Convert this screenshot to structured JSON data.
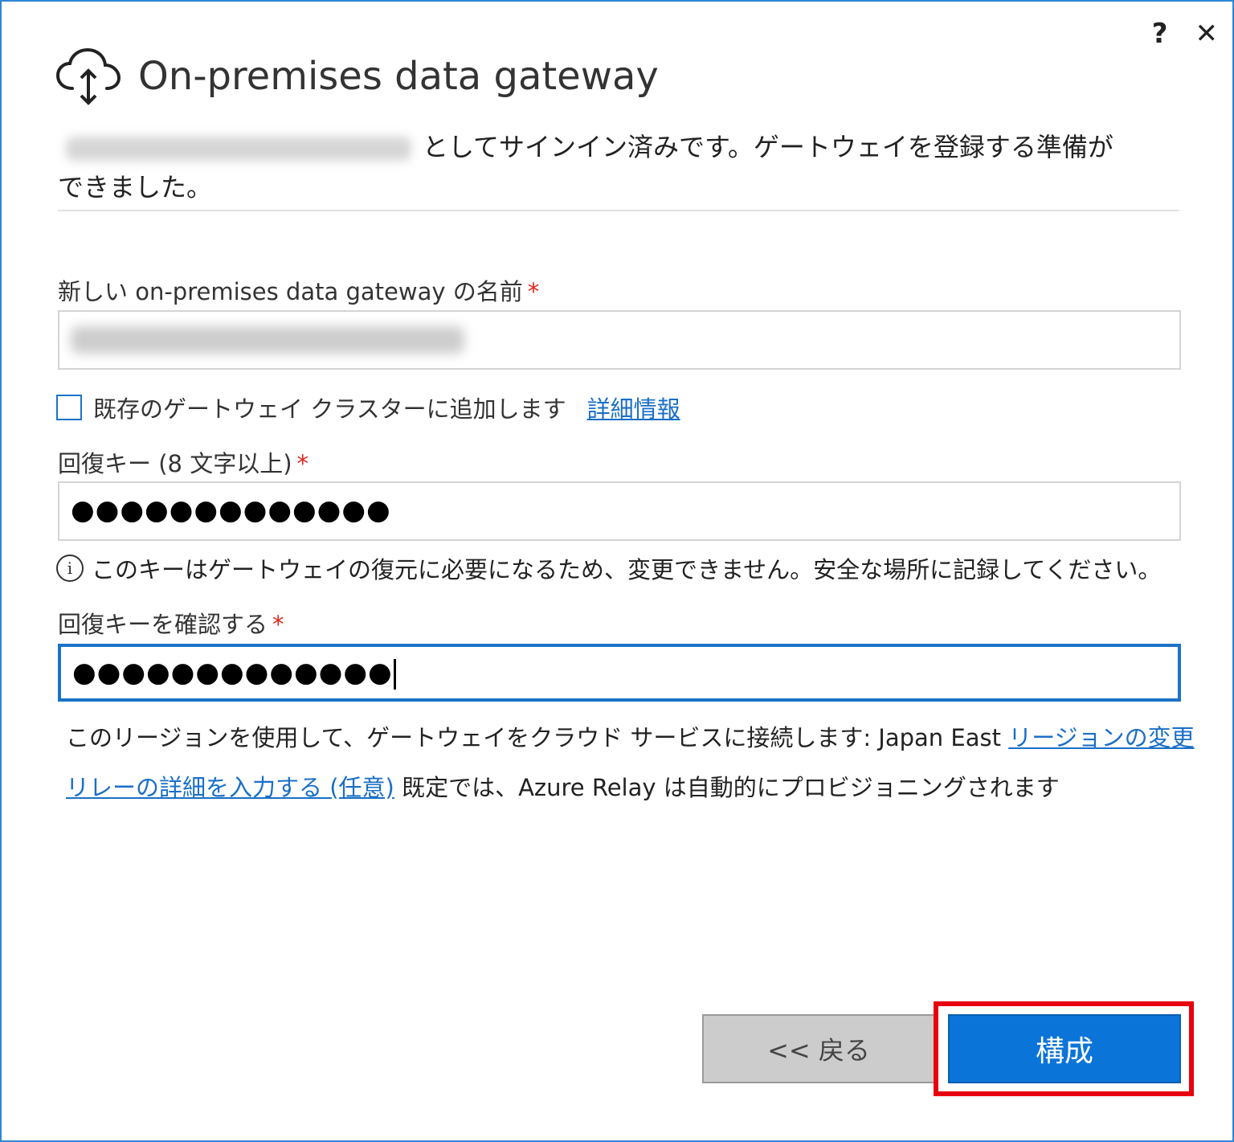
{
  "window": {
    "help_label": "?",
    "close_label": "✕"
  },
  "header": {
    "title": "On-premises data gateway",
    "icon": "cloud-upload-icon"
  },
  "signed_in": {
    "message": "としてサインイン済みです。ゲートウェイを登録する準備ができました。"
  },
  "gateway_name": {
    "label": "新しい on-premises data gateway の名前",
    "required_mark": "*"
  },
  "cluster": {
    "checkbox_label": "既存のゲートウェイ クラスターに追加します",
    "checked": false,
    "learn_more": "詳細情報"
  },
  "recovery_key": {
    "label": "回復キー (8 文字以上)",
    "required_mark": "*",
    "value_masked": "●●●●●●●●●●●●●"
  },
  "recovery_info": {
    "icon": "info-icon",
    "text": "このキーはゲートウェイの復元に必要になるため、変更できません。安全な場所に記録してください。"
  },
  "confirm_key": {
    "label": "回復キーを確認する",
    "required_mark": "*",
    "value_masked": "●●●●●●●●●●●●●"
  },
  "region": {
    "text": "このリージョンを使用して、ゲートウェイをクラウド サービスに接続します: Japan East",
    "change_link": "リージョンの変更"
  },
  "relay": {
    "link": "リレーの詳細を入力する (任意)",
    "text": "既定では、Azure Relay は自動的にプロビジョニングされます"
  },
  "buttons": {
    "back": "<< 戻る",
    "configure": "構成"
  },
  "colors": {
    "accent": "#0b74d9",
    "link": "#1a6fc7",
    "required": "#e0261b",
    "highlight": "#e8000d"
  }
}
